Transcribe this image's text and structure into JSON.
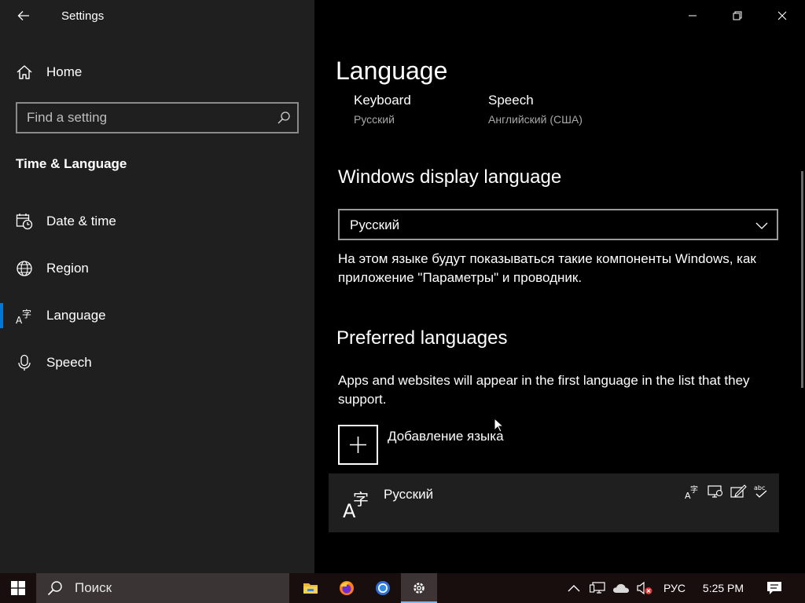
{
  "window": {
    "title": "Settings"
  },
  "sidebar": {
    "home_label": "Home",
    "search_placeholder": "Find a setting",
    "section_title": "Time & Language",
    "items": [
      {
        "label": "Date & time",
        "icon": "calendar-clock-icon"
      },
      {
        "label": "Region",
        "icon": "globe-icon"
      },
      {
        "label": "Language",
        "icon": "language-icon",
        "active": true
      },
      {
        "label": "Speech",
        "icon": "microphone-icon"
      }
    ]
  },
  "main": {
    "title": "Language",
    "summary": [
      {
        "title": "Keyboard",
        "value": "Русский"
      },
      {
        "title": "Speech",
        "value": "Английский (США)"
      }
    ],
    "display_language": {
      "heading": "Windows display language",
      "selected": "Русский",
      "description": "На этом языке будут показываться такие компоненты Windows, как приложение \"Параметры\" и проводник."
    },
    "preferred": {
      "heading": "Preferred languages",
      "description": "Apps and websites will appear in the first language in the list that they support.",
      "add_label": "Добавление языка",
      "languages": [
        {
          "name": "Русский",
          "features": [
            "display-language-icon",
            "speech-icon",
            "handwriting-icon",
            "spellcheck-icon"
          ]
        }
      ]
    }
  },
  "taskbar": {
    "search_label": "Поиск",
    "apps": [
      "file-explorer-icon",
      "firefox-icon",
      "chrome-icon",
      "settings-icon"
    ],
    "language_indicator": "РУС",
    "time": "5:25 PM"
  },
  "colors": {
    "accent": "#0078d7",
    "sidebar_bg": "#1f1f1f",
    "main_bg": "#000000",
    "taskbar_bg": "#180e0e"
  }
}
